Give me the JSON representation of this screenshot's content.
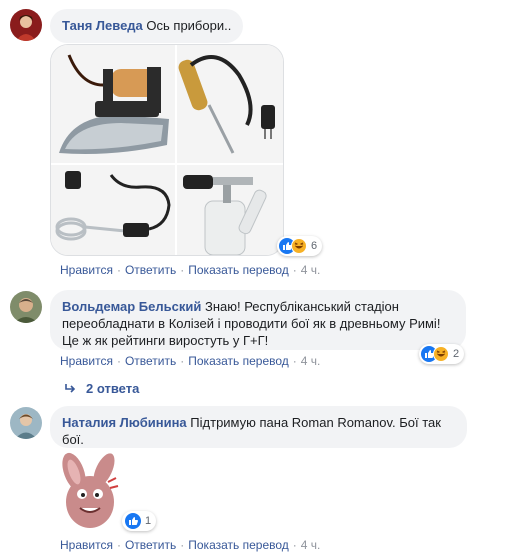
{
  "comments": [
    {
      "author": "Таня Леведа",
      "text": "Ось прибори..",
      "reactions_count": "6",
      "actions": {
        "like": "Нравится",
        "reply": "Ответить",
        "translate": "Показать перевод",
        "time": "4 ч."
      }
    },
    {
      "author": "Вольдемар Бельский",
      "text": "Знаю! Республіканський стадіон переобладнати в Колізей і проводити бої як в древньому Римі! Це ж як рейтинги виростуть у Г+Г!",
      "reactions_count": "2",
      "actions": {
        "like": "Нравится",
        "reply": "Ответить",
        "translate": "Показать перевод",
        "time": "4 ч."
      },
      "replies_label": "2 ответа"
    },
    {
      "author": "Наталия Любинина",
      "text": "Підтримую пана Roman Romanov. Бої так бої.",
      "reactions_count": "1",
      "actions": {
        "like": "Нравится",
        "reply": "Ответить",
        "translate": "Показать перевод",
        "time": "4 ч."
      }
    }
  ],
  "colors": {
    "link": "#385898",
    "bubble": "#f2f3f5",
    "meta": "#90949c",
    "like": "#1877f2",
    "haha": "#f7b125"
  },
  "icons": [
    "like-reaction-icon",
    "haha-reaction-icon",
    "reply-arrow-icon"
  ]
}
